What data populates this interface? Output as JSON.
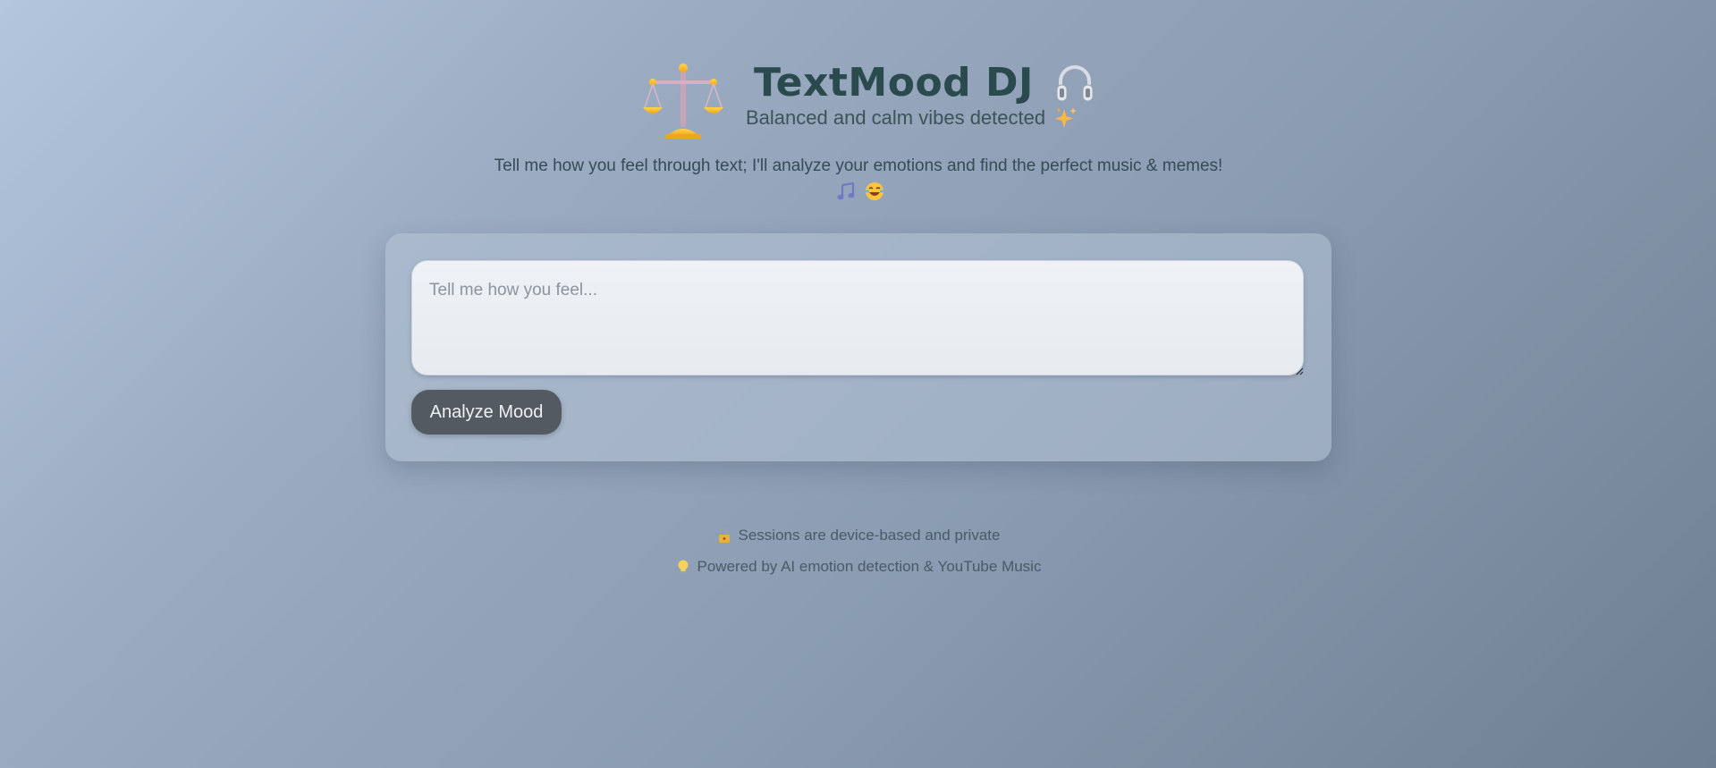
{
  "header": {
    "mood_emoji": "balance-scale-icon",
    "title": "TextMood DJ",
    "title_icon": "headphones-icon",
    "subtitle": "Balanced and calm vibes detected",
    "subtitle_icon": "sparkles-icon"
  },
  "intro": {
    "text": "Tell me how you feel through text; I'll analyze your emotions and find the perfect music & memes!",
    "icons": [
      "music-note-icon",
      "laughing-face-icon"
    ]
  },
  "form": {
    "placeholder": "Tell me how you feel...",
    "value": "",
    "analyze_label": "Analyze Mood"
  },
  "footer": {
    "privacy_text": "Sessions are device-based and private",
    "privacy_icon": "lock-icon",
    "powered_text": "Powered by AI emotion detection & YouTube Music",
    "powered_icon": "lightbulb-icon"
  },
  "colors": {
    "title": "#2a4a4e",
    "button_bg": "#545a61",
    "button_text": "#eef0f2"
  }
}
